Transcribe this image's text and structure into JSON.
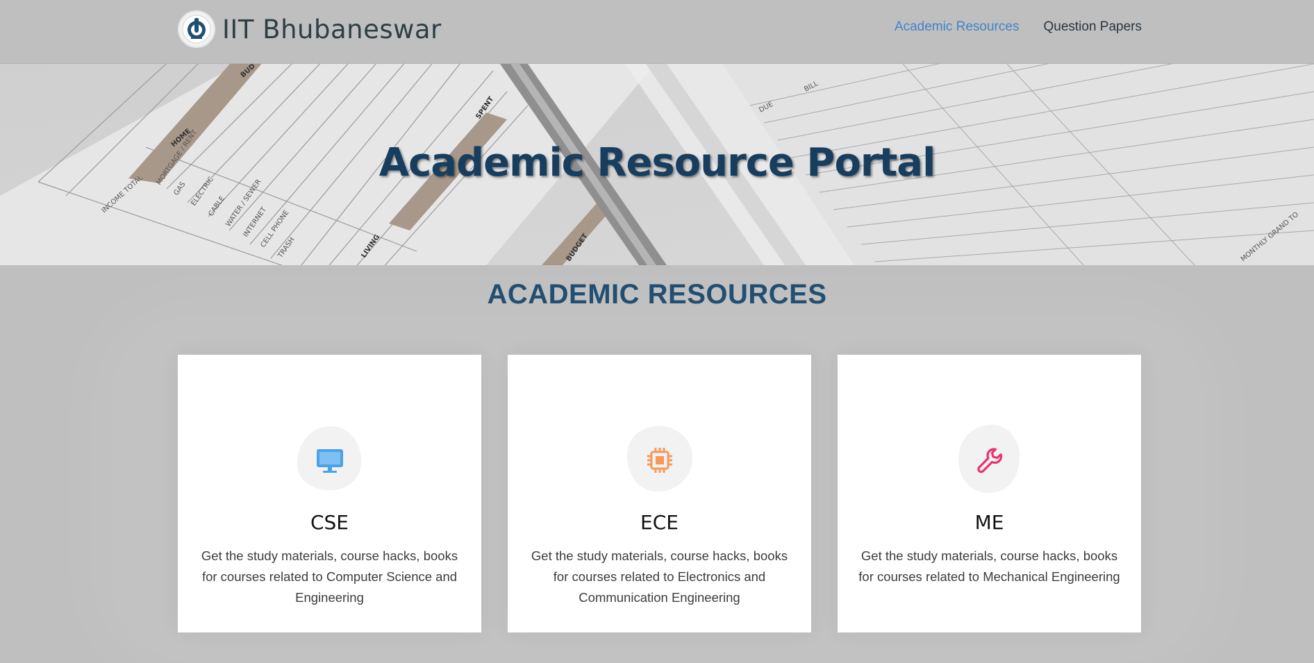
{
  "header": {
    "brand": "IIT Bhubaneswar",
    "nav": [
      {
        "label": "Academic Resources",
        "active": true
      },
      {
        "label": "Question Papers",
        "active": false
      }
    ]
  },
  "hero": {
    "title": "Academic Resource Portal",
    "image_text": [
      "INCOME TOTAL",
      "BUD",
      "HOME",
      "MORTGAGE / RENT",
      "GAS",
      "ELECTRIC",
      "CABLE",
      "WATER / SEWER",
      "INTERNET",
      "CELL PHONE",
      "TRASH",
      "LIVING",
      "SPENT",
      "BUDGET",
      "DUE",
      "BILL",
      "MONTHLY GRAND TO"
    ]
  },
  "section": {
    "title": "ACADEMIC RESOURCES"
  },
  "cards": [
    {
      "title": "CSE",
      "description": "Get the study materials, course hacks, books for courses related to Computer Science and Engineering",
      "icon": "monitor-icon",
      "color": "#4aa3e8"
    },
    {
      "title": "ECE",
      "description": "Get the study materials, course hacks, books for courses related to Electronics and Communication Engineering",
      "icon": "chip-icon",
      "color": "#f59a5a"
    },
    {
      "title": "ME",
      "description": "Get the study materials, course hacks, books for courses related to Mechanical Engineering",
      "icon": "wrench-icon",
      "color": "#e8326f"
    }
  ]
}
